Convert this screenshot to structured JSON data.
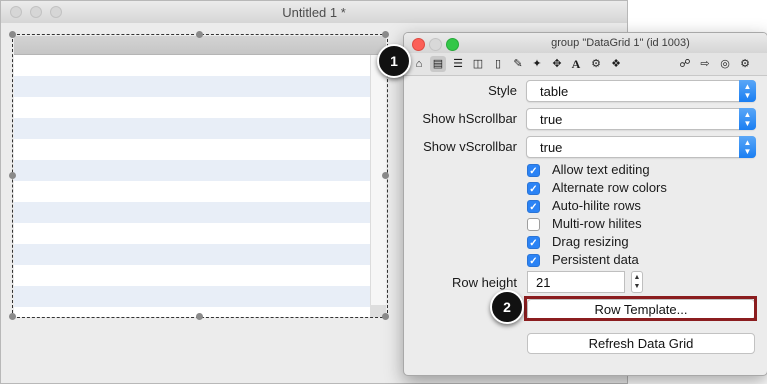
{
  "main_window": {
    "title": "Untitled 1 *"
  },
  "inspector": {
    "title": "group \"DataGrid 1\" (id 1003)",
    "toolbar_icons": [
      "home-icon",
      "datagrid-icon",
      "list-icon",
      "columns-icon",
      "database-icon",
      "pencil-icon",
      "wand-icon",
      "move-icon",
      "text-icon",
      "gears-icon",
      "resize-icon",
      "lock-icon",
      "export-icon",
      "target-icon",
      "gear-icon"
    ],
    "style": {
      "label": "Style",
      "value": "table"
    },
    "hscroll": {
      "label": "Show hScrollbar",
      "value": "true"
    },
    "vscroll": {
      "label": "Show vScrollbar",
      "value": "true"
    },
    "checkboxes": [
      {
        "label": "Allow text editing",
        "checked": true
      },
      {
        "label": "Alternate row colors",
        "checked": true
      },
      {
        "label": "Auto-hilite rows",
        "checked": true
      },
      {
        "label": "Multi-row hilites",
        "checked": false
      },
      {
        "label": "Drag resizing",
        "checked": true
      },
      {
        "label": "Persistent data",
        "checked": true
      }
    ],
    "row_height": {
      "label": "Row height",
      "value": "21"
    },
    "row_template_label": "Row Template...",
    "refresh_label": "Refresh Data Grid"
  },
  "callouts": [
    "1",
    "2"
  ],
  "colors": {
    "accent": "#2b83f5",
    "highlight_border": "#8b1d1f",
    "row_alt": "#e8eef7"
  }
}
